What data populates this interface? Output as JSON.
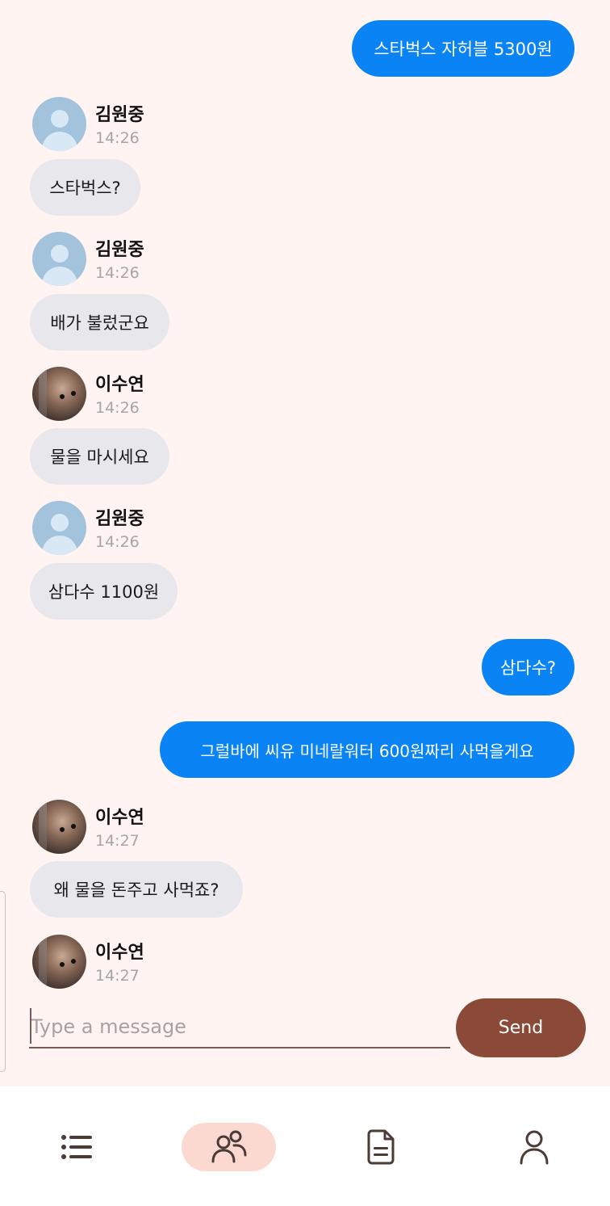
{
  "messages": [
    {
      "type": "sent",
      "text": "스타벅스 자허블 5300원"
    },
    {
      "type": "received",
      "sender": "김원중",
      "time": "14:26",
      "text": "스타벅스?",
      "avatar": "default-avatar"
    },
    {
      "type": "received",
      "sender": "김원중",
      "time": "14:26",
      "text": "배가 불렀군요",
      "avatar": "default-avatar"
    },
    {
      "type": "received",
      "sender": "이수연",
      "time": "14:26",
      "text": "물을 마시세요",
      "avatar": "photo-avatar"
    },
    {
      "type": "received",
      "sender": "김원중",
      "time": "14:26",
      "text": "삼다수 1100원",
      "avatar": "default-avatar"
    },
    {
      "type": "sent",
      "text": "삼다수?"
    },
    {
      "type": "sent",
      "text": "그럴바에 씨유 미네랄워터 600원짜리 사먹을게요"
    },
    {
      "type": "received",
      "sender": "이수연",
      "time": "14:27",
      "text": "왜 물을 돈주고 사먹죠?",
      "avatar": "photo-avatar"
    },
    {
      "type": "received",
      "sender": "이수연",
      "time": "14:27",
      "text": "",
      "avatar": "photo-avatar"
    }
  ],
  "composer": {
    "placeholder": "Type a message",
    "value": "",
    "send_label": "Send"
  },
  "bottom_nav": [
    {
      "id": "list",
      "icon": "list-icon",
      "active": false
    },
    {
      "id": "friends",
      "icon": "people-icon",
      "active": true
    },
    {
      "id": "documents",
      "icon": "document-icon",
      "active": false
    },
    {
      "id": "profile",
      "icon": "person-icon",
      "active": false
    }
  ],
  "colors": {
    "background": "#fff4f1",
    "sent_bubble": "#0a84f5",
    "received_bubble": "#e8e8ec",
    "send_button": "#8b4a38",
    "nav_active": "#fbd9d0"
  }
}
